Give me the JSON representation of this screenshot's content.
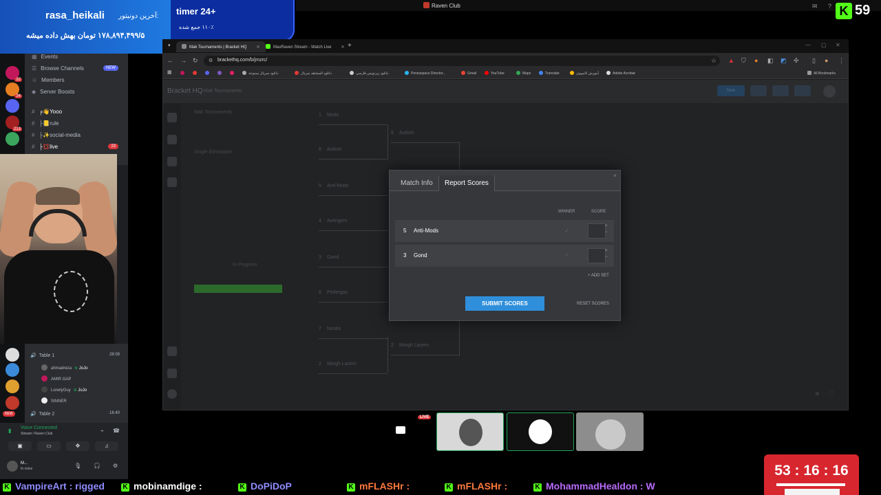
{
  "window": {
    "title": "Raven Club"
  },
  "donation": {
    "label": "آخرین دونیتور:",
    "user": "rasa_heikali",
    "amount_text": "۱۷۸,۸۹۴,۴۹۹/۵ تومان بهش داده میشه",
    "timer_title": "timer 24+",
    "timer_sub": "۱۱۰٪ جمع شده"
  },
  "kick": {
    "viewer_count": "59",
    "logo_letter": "K"
  },
  "discord": {
    "channels": [
      {
        "label": "Events",
        "icon": "calendar-icon"
      },
      {
        "label": "Browse Channels",
        "icon": "browse-icon",
        "badge": "NEW"
      },
      {
        "label": "Members",
        "icon": "members-icon"
      },
      {
        "label": "Server Boosts",
        "icon": "boost-icon"
      },
      {
        "label": "╒👋Yooo",
        "icon": "hash-icon"
      },
      {
        "label": "├📒rule",
        "icon": "hash-icon"
      },
      {
        "label": "├✨social-media",
        "icon": "hash-icon"
      },
      {
        "label": "├💢live",
        "icon": "hash-icon",
        "count": "23"
      }
    ],
    "server_badges": [
      "22",
      "24",
      "213"
    ],
    "voice": {
      "table1": {
        "label": "Table 1",
        "time": "28:08"
      },
      "users": [
        {
          "name": "ahmadreza",
          "tag": "JoJo"
        },
        {
          "name": "AMIR GAP",
          "tag": ""
        },
        {
          "name": "LonelyGuy",
          "tag": "JoJo"
        },
        {
          "name": "SINNER",
          "tag": ""
        }
      ],
      "table2": {
        "label": "Table 2",
        "time": "16:40"
      },
      "connected": "Voice Connected",
      "where": "Stream / Raven Club"
    },
    "user": {
      "name": "M...",
      "status": "In voice"
    },
    "new_label": "NEW"
  },
  "browser": {
    "tabs": [
      {
        "label": "Mak Tournaments | Bracket HQ",
        "active": true
      },
      {
        "label": "MaxRaven Stream - Watch Live",
        "active": false
      }
    ],
    "url": "brackethq.com/b/jmzrc/",
    "bookmarks": [
      "دانلود سریال ممنوعه",
      "دانلود المشاهد سریال",
      "دانلود زیرنویس فارسی",
      "Persiaspace Director...",
      "Gmail",
      "YouTube",
      "Maps",
      "Translate",
      "آموزش کامپیوتر",
      "Adobe Acrobat"
    ],
    "all_bookmarks": "All Bookmarks"
  },
  "bracket": {
    "logo": "Bracket HQ",
    "subtitle": "Mak Tournaments",
    "new_button": "New",
    "teams": [
      {
        "seed": "1",
        "name": "Mods"
      },
      {
        "seed": "8",
        "name": "Autism"
      },
      {
        "seed": "5",
        "name": "Anti-Mods"
      },
      {
        "seed": "4",
        "name": "Avengers"
      },
      {
        "seed": "3",
        "name": "Gond"
      },
      {
        "seed": "6",
        "name": "Pedergas"
      },
      {
        "seed": "7",
        "name": "Noobs"
      },
      {
        "seed": "2",
        "name": "Morgh Lazem"
      }
    ],
    "round2": [
      {
        "seed": "8",
        "name": "Autism"
      },
      {
        "seed": "2",
        "name": "Morgh Lazem"
      }
    ],
    "sidebar_text": [
      "Mak Tournaments",
      "Single Elimination",
      "In Progress"
    ]
  },
  "modal": {
    "tabs": [
      "Match Info",
      "Report Scores"
    ],
    "close": "×",
    "col_winner": "WINNER",
    "col_score": "SCORE",
    "rows": [
      {
        "seed": "5",
        "name": "Anti-Mods"
      },
      {
        "seed": "3",
        "name": "Gond"
      }
    ],
    "add_set": "+ ADD SET",
    "submit": "SUBMIT SCORES",
    "reset": "RESET SCORES"
  },
  "stream": {
    "live_label": "LIVE"
  },
  "countdown": "53 : 16 : 16",
  "ticker": [
    {
      "text": "VampireArt : rigged",
      "color": "#8f8cff"
    },
    {
      "text": "mobinamdige :",
      "color": "#ffffff"
    },
    {
      "text": "DoPiDoP",
      "color": "#8f8cff"
    },
    {
      "text": "mFLASHr :",
      "color": "#ff7a3d"
    },
    {
      "text": "mFLASHr :",
      "color": "#ff7a3d"
    },
    {
      "text": "MohammadHealdon : W",
      "color": "#b86bff"
    }
  ],
  "colors": {
    "kick_green": "#53fc18",
    "accent_blue": "#2f8fdb",
    "live_red": "#da373c",
    "timer_red": "#d8262e"
  }
}
